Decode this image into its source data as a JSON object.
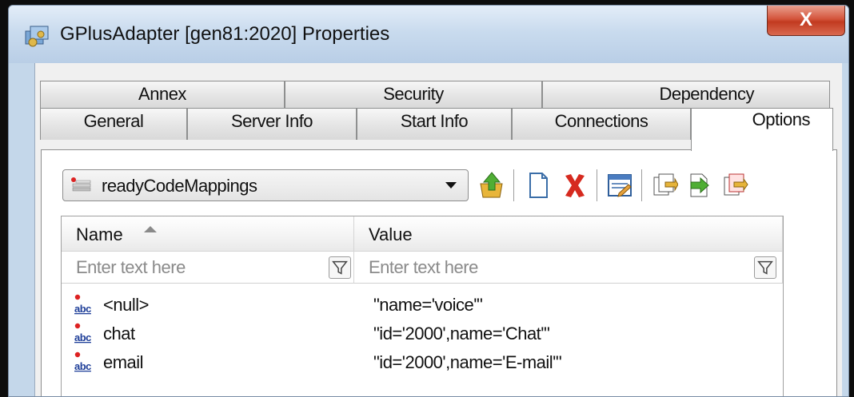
{
  "window": {
    "title": "GPlusAdapter [gen81:2020] Properties",
    "close_label": "X"
  },
  "tabs_row1": [
    {
      "label": "Annex"
    },
    {
      "label": "Security"
    },
    {
      "label": "Dependency"
    }
  ],
  "tabs_row2": [
    {
      "label": "General"
    },
    {
      "label": "Server Info"
    },
    {
      "label": "Start Info"
    },
    {
      "label": "Connections"
    },
    {
      "label": "Options",
      "active": true
    }
  ],
  "options": {
    "section_combo": {
      "selected": "readyCodeMappings",
      "icon": "section-list-icon"
    },
    "toolbar": [
      {
        "icon": "up-arrow-folder-icon"
      },
      {
        "icon": "new-document-icon"
      },
      {
        "icon": "delete-x-icon"
      },
      {
        "icon": "edit-properties-icon"
      },
      {
        "icon": "copy-section-icon"
      },
      {
        "icon": "import-icon"
      },
      {
        "icon": "export-icon"
      }
    ],
    "grid": {
      "columns": [
        "Name",
        "Value"
      ],
      "sorted_column": "Name",
      "filter_placeholders": [
        "Enter text here",
        "Enter text here"
      ],
      "rows": [
        {
          "icon": "string-abc-icon",
          "name": "<null>",
          "value": "\"name='voice'\""
        },
        {
          "icon": "string-abc-icon",
          "name": "chat",
          "value": "\"id='2000',name='Chat'\""
        },
        {
          "icon": "string-abc-icon",
          "name": "email",
          "value": "\"id='2000',name='E-mail'\""
        }
      ]
    }
  },
  "colors": {
    "close_button": "#c9442a",
    "delete_icon": "#d62a1f",
    "title_bar": "#c9dbee",
    "panel": "#ffffff"
  }
}
